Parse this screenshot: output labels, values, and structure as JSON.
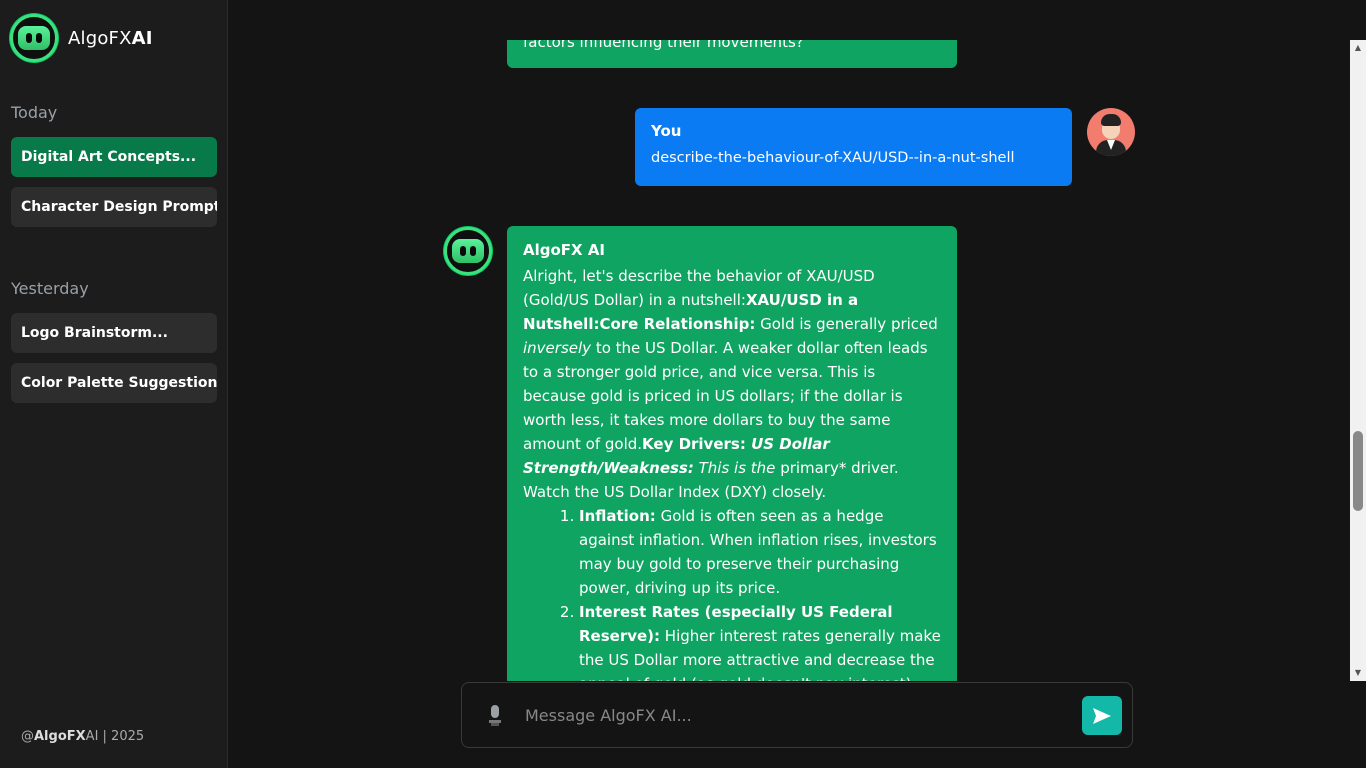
{
  "brand": {
    "name_plain": "AlgoFX",
    "name_bold": "AI"
  },
  "sidebar": {
    "today_label": "Today",
    "today_items": [
      {
        "label": "Digital Art Concepts...",
        "active": true
      },
      {
        "label": "Character Design Prompts...",
        "active": false
      }
    ],
    "yesterday_label": "Yesterday",
    "yesterday_items": [
      {
        "label": "Logo Brainstorm..."
      },
      {
        "label": "Color Palette Suggestions..."
      }
    ],
    "footer": {
      "at": "@",
      "brand_bold": "AlgoFX",
      "brand_plain": "AI",
      "year": " | 2025"
    }
  },
  "chat": {
    "previous_ai_tail": "factors influencing their movements?",
    "user": {
      "name": "You",
      "message": "describe-the-behaviour-of-XAU/USD--in-a-nut-shell"
    },
    "ai": {
      "name": "AlgoFX AI",
      "intro": "Alright, let's describe the behavior of XAU/USD (Gold/US Dollar) in a nutshell:",
      "heading1": "XAU/USD in a Nutshell:",
      "core_label": "Core Relationship:",
      "core_text_a": " Gold is generally priced ",
      "core_text_em": "inversely",
      "core_text_b": " to the US Dollar. A weaker dollar often leads to a stronger gold price, and vice versa. This is because gold is priced in US dollars; if the dollar is worth less, it takes more dollars to buy the same amount of gold.",
      "drivers_label": "Key Drivers: ",
      "drivers_em_bold": "US Dollar Strength/Weakness:",
      "drivers_em": " This is the ",
      "drivers_text": "primary* driver. Watch the US Dollar Index (DXY) closely.",
      "list": [
        {
          "label": "Inflation:",
          "text": " Gold is often seen as a hedge against inflation. When inflation rises, investors may buy gold to preserve their purchasing power, driving up its price."
        },
        {
          "label": "Interest Rates (especially US Federal Reserve):",
          "text": " Higher interest rates generally make the US Dollar more attractive and decrease the appeal of gold (as gold doesn't pay interest)."
        }
      ]
    }
  },
  "input": {
    "placeholder": "Message AlgoFX AI..."
  },
  "colors": {
    "accent_green": "#10a462",
    "user_blue": "#0a7bf3",
    "send_teal": "#13b8a8",
    "active_nav": "#087a4a"
  }
}
